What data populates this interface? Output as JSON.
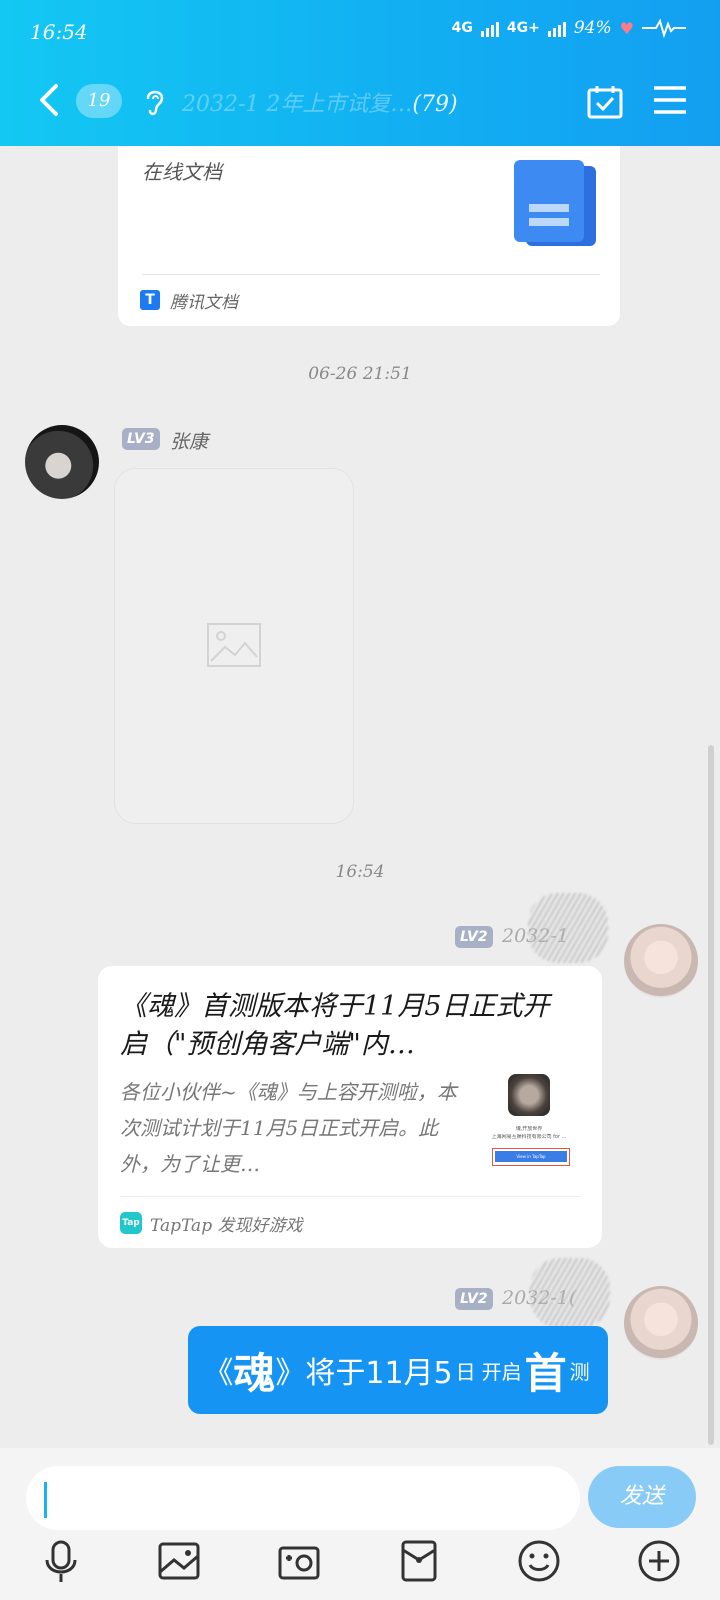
{
  "status_bar": {
    "time": "16:54",
    "network1": "4G",
    "network2": "4G+",
    "battery": "94%"
  },
  "header": {
    "unread_count": "19",
    "title_visible": "2032-1 ",
    "title_blurred": "2年上市试复…",
    "member_count": "(79)"
  },
  "doc_card": {
    "description": "在线文档",
    "source": "腾讯文档",
    "source_icon": "T"
  },
  "timestamps": [
    "06-26 21:51",
    "16:54"
  ],
  "message1": {
    "level": "LV3",
    "sender": "张康",
    "image_icon": "image-placeholder-icon"
  },
  "message2": {
    "level": "LV2",
    "sender": "2032-1",
    "card_title": "《魂》首测版本将于11月5日正式开启（\"预创角客户端\"内…",
    "card_desc": "各位小伙伴~《魂》与上容开测啦，本次测试计划于11月5日正式开启。此外，为了让更…",
    "thumb_lines": [
      "魂,开放世界",
      "上海网易互娱科技有限公司 for ..."
    ],
    "thumb_button": "View in TapTap",
    "source_icon": "Tap",
    "source": "TapTap 发现好游戏"
  },
  "message3": {
    "level": "LV2",
    "sender": "2032-1(",
    "text_pre": "《",
    "text_big1": "魂",
    "text_mid": "》将于11月5",
    "text_day": "日",
    "text_small1": "开启",
    "text_big2": "首",
    "text_small2": "测"
  },
  "input": {
    "placeholder": "",
    "send_label": "发送"
  },
  "toolbar": [
    "mic-icon",
    "picture-icon",
    "camera-icon",
    "red-packet-icon",
    "emoji-icon",
    "plus-icon"
  ],
  "colors": {
    "header": "#13aef2",
    "bubble": "#1694f3",
    "send": "#88cbf6",
    "level_badge": "#a7b0c4"
  }
}
